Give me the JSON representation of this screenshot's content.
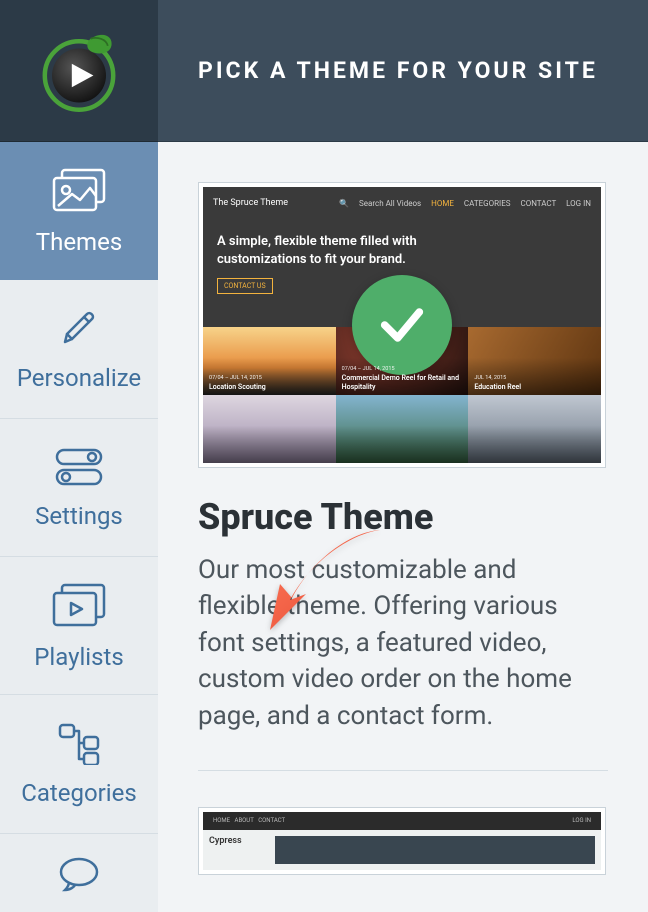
{
  "header": {
    "title": "PICK A THEME FOR YOUR SITE"
  },
  "sidebar": {
    "items": [
      {
        "label": "Themes"
      },
      {
        "label": "Personalize"
      },
      {
        "label": "Settings"
      },
      {
        "label": "Playlists"
      },
      {
        "label": "Categories"
      }
    ]
  },
  "themes": [
    {
      "name": "Spruce Theme",
      "description": "Our most customizable and flexible theme. Offering various font settings, a featured video, custom video order on the home page, and a contact form.",
      "selected": true,
      "preview": {
        "brand": "The Spruce Theme",
        "search_placeholder": "Search All Videos",
        "nav_links": [
          "HOME",
          "CATEGORIES",
          "CONTACT",
          "LOG IN"
        ],
        "hero_headline": "A simple, flexible theme filled with customizations to fit your brand.",
        "cta": "CONTACT US",
        "tiles": [
          {
            "date": "07/04 – JUL 14, 2015",
            "title": "Location Scouting"
          },
          {
            "date": "07/04 – JUL 14, 2015",
            "title": "Commercial Demo Reel for Retail and Hospitality"
          },
          {
            "date": "JUL 14, 2015",
            "title": "Education Reel"
          },
          {
            "date": "",
            "title": ""
          },
          {
            "date": "",
            "title": ""
          },
          {
            "date": "",
            "title": ""
          }
        ]
      }
    },
    {
      "name": "Cypress",
      "preview": {
        "brand": "Cypress",
        "nav_links": [
          "HOME",
          "ABOUT",
          "CONTACT"
        ],
        "right": "LOG IN"
      }
    }
  ]
}
